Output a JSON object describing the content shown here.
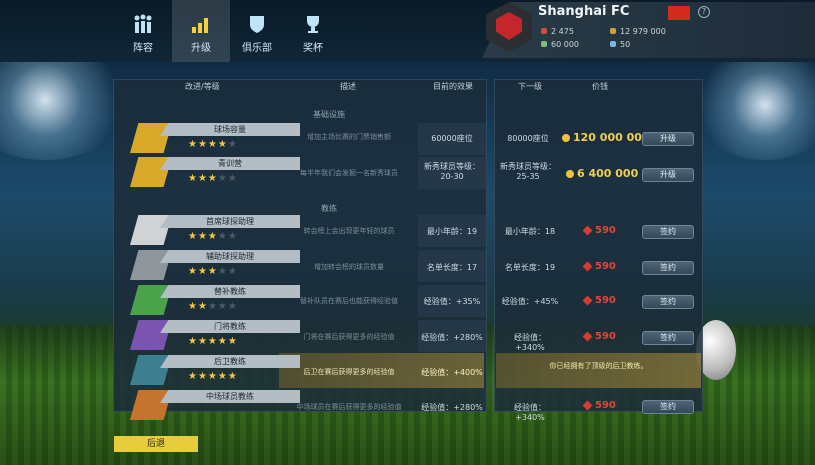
{
  "nav": {
    "items": [
      {
        "label": "阵容",
        "icon": "squad-icon"
      },
      {
        "label": "升级",
        "icon": "chart-icon"
      },
      {
        "label": "俱乐部",
        "icon": "shield-icon"
      },
      {
        "label": "奖杯",
        "icon": "trophy-icon"
      }
    ],
    "active": "升级"
  },
  "club": {
    "name": "Shanghai FC",
    "stats": {
      "fans": "2 475",
      "coins": "12 979 000",
      "cash": "60 000",
      "players": "50"
    }
  },
  "headers": {
    "improve": "改进/等级",
    "description": "描述",
    "current": "目前的效果",
    "next": "下一级",
    "price": "价钱"
  },
  "sections": {
    "infra": "基础设施",
    "coaches": "教练"
  },
  "rows": [
    {
      "name": "球场容量",
      "desc": "增加主场比赛的门票销售额",
      "current": "60000座位",
      "next": "80000座位",
      "price": "120 000 000",
      "button": "升级"
    },
    {
      "name": "青训营",
      "desc": "每半年我们会发掘一名新秀球员",
      "current": "新秀球员等级：20-30",
      "next": "新秀球员等级：25-35",
      "price": "6 400 000",
      "button": "升级"
    },
    {
      "name": "首席球探助理",
      "desc": "转会榜上会出现更年轻的球员",
      "current": "最小年龄：19",
      "next": "最小年龄：18",
      "price": "590",
      "button": "签约"
    },
    {
      "name": "辅助球探助理",
      "desc": "增加转会榜的球员数量",
      "current": "名单长度：17",
      "next": "名单长度：19",
      "price": "590",
      "button": "签约"
    },
    {
      "name": "替补教练",
      "desc": "替补队员在赛后也能获得经验值",
      "current": "经验值：+35%",
      "next": "经验值：+45%",
      "price": "590",
      "button": "签约"
    },
    {
      "name": "门将教练",
      "desc": "门将在赛后获得更多的经验值",
      "current": "经验值：+280%",
      "next": "经验值：+340%",
      "price": "590",
      "button": "签约"
    },
    {
      "name": "后卫教练",
      "desc": "后卫在赛后获得更多的经验值",
      "current": "经验值：+400%",
      "message": "你已经拥有了顶级的后卫教练。"
    },
    {
      "name": "中场球员教练",
      "desc": "中场球员在赛后获得更多的经验值",
      "current": "经验值：+280%",
      "next": "经验值：+340%",
      "price": "590",
      "button": "签约"
    }
  ],
  "back_label": "后退",
  "colors": {
    "accent": "#e7cd3c",
    "price": "#f3cf4a",
    "gem": "#d73b2f"
  }
}
